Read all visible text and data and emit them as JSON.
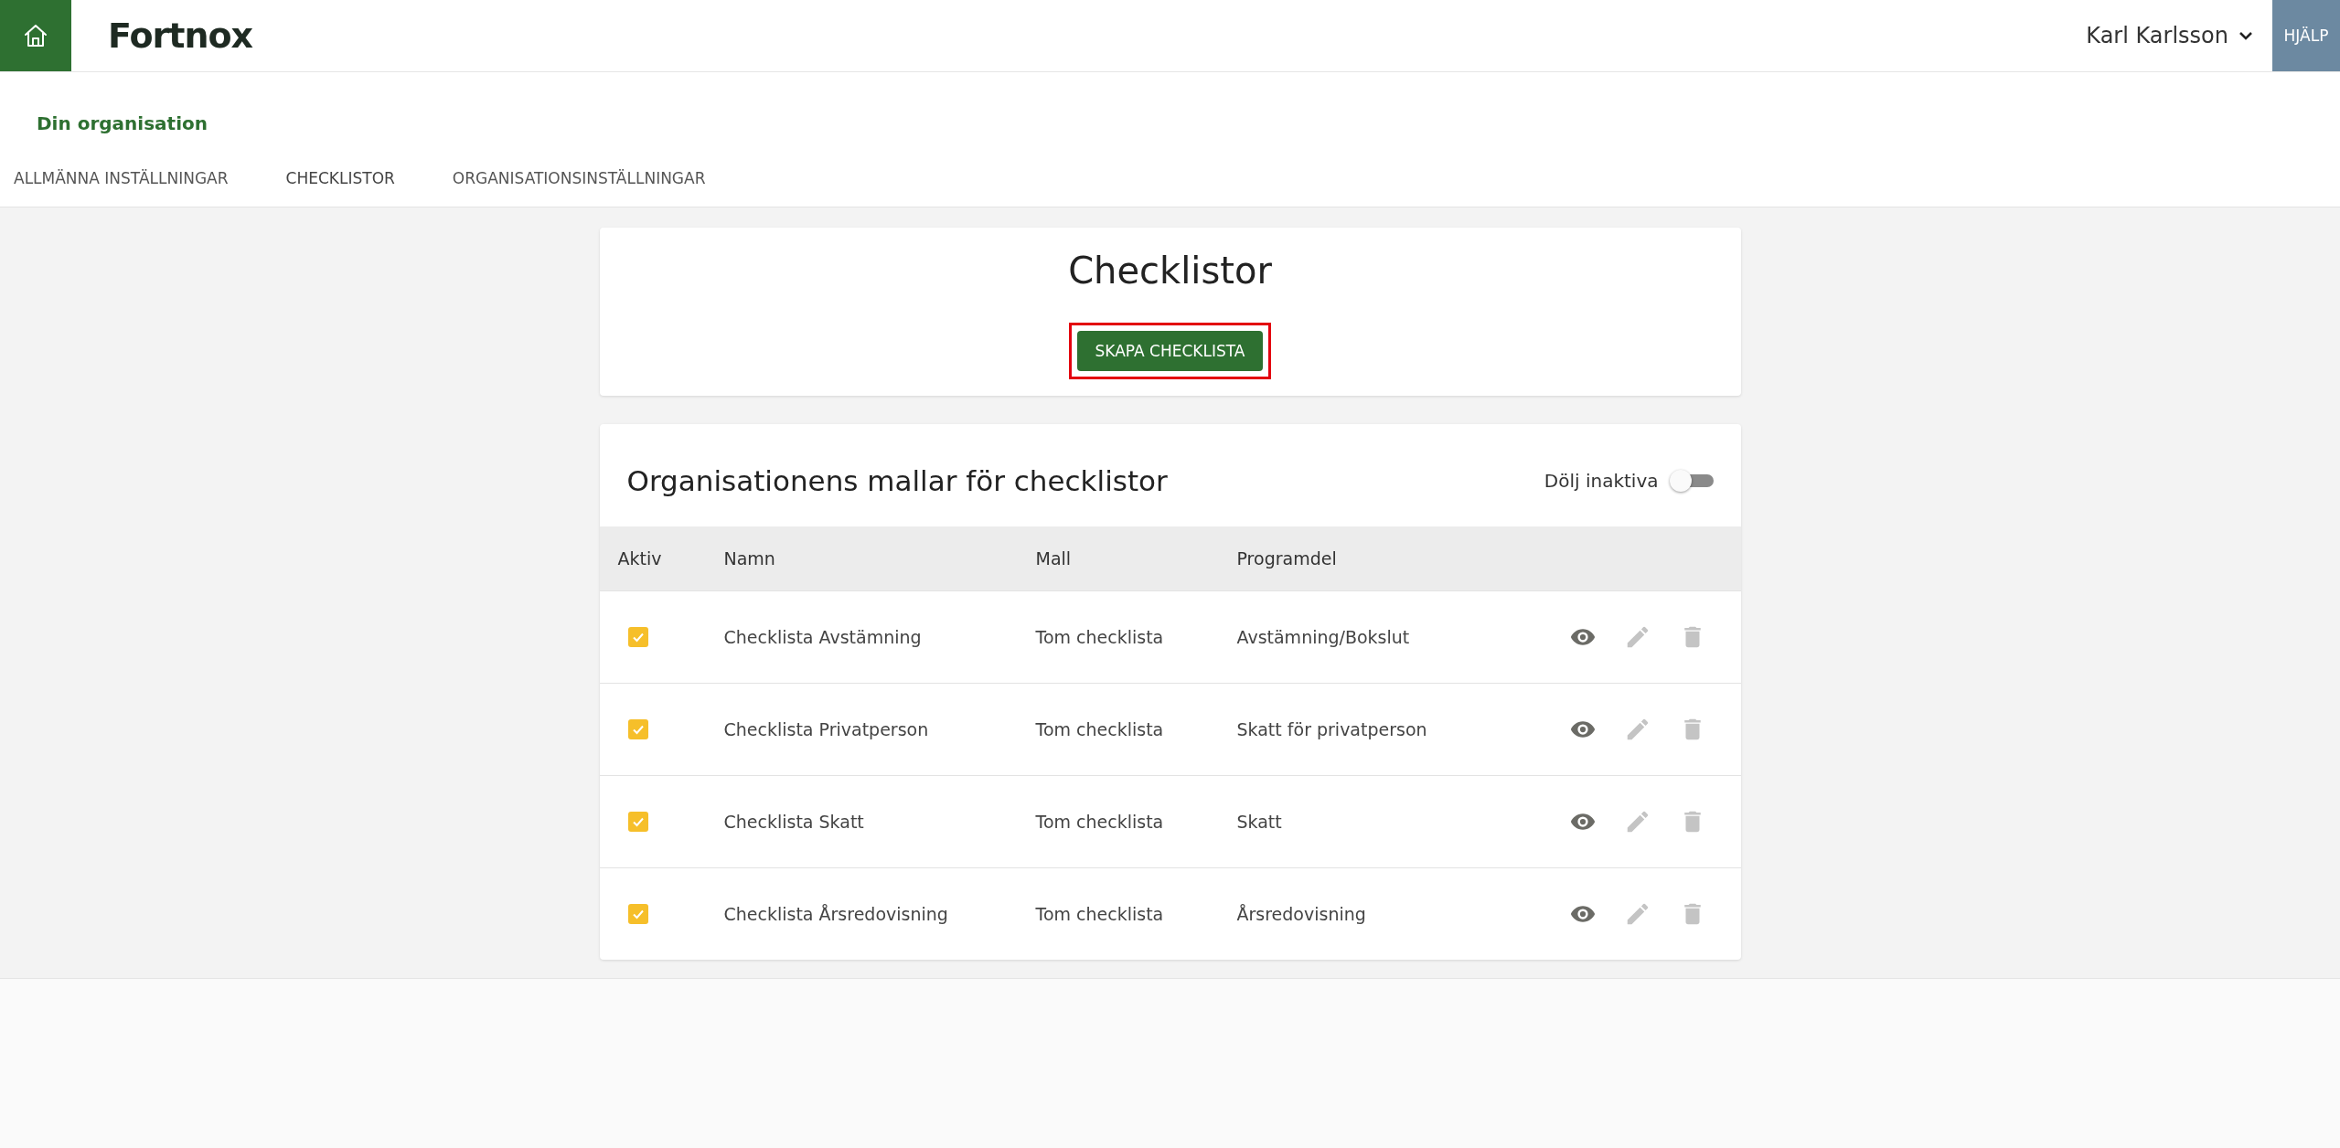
{
  "header": {
    "logo": "Fortnox",
    "user": "Karl Karlsson",
    "help": "HJÄLP"
  },
  "section_title": "Din organisation",
  "tabs": [
    {
      "label": "ALLMÄNNA INSTÄLLNINGAR",
      "selected": false
    },
    {
      "label": "CHECKLISTOR",
      "selected": true
    },
    {
      "label": "ORGANISATIONSINSTÄLLNINGAR",
      "selected": false
    }
  ],
  "create_card": {
    "title": "Checklistor",
    "button": {
      "label": "SKAPA CHECKLISTA",
      "highlighted": true
    }
  },
  "templates": {
    "title": "Organisationens mallar för checklistor",
    "hide_inactive": {
      "label": "Dölj inaktiva",
      "on": false
    },
    "columns": [
      "Aktiv",
      "Namn",
      "Mall",
      "Programdel"
    ],
    "rows": [
      {
        "active": true,
        "name": "Checklista Avstämning",
        "template": "Tom checklista",
        "module": "Avstämning/Bokslut"
      },
      {
        "active": true,
        "name": "Checklista Privatperson",
        "template": "Tom checklista",
        "module": "Skatt för privatperson"
      },
      {
        "active": true,
        "name": "Checklista Skatt",
        "template": "Tom checklista",
        "module": "Skatt"
      },
      {
        "active": true,
        "name": "Checklista Årsredovisning",
        "template": "Tom checklista",
        "module": "Årsredovisning"
      }
    ]
  }
}
